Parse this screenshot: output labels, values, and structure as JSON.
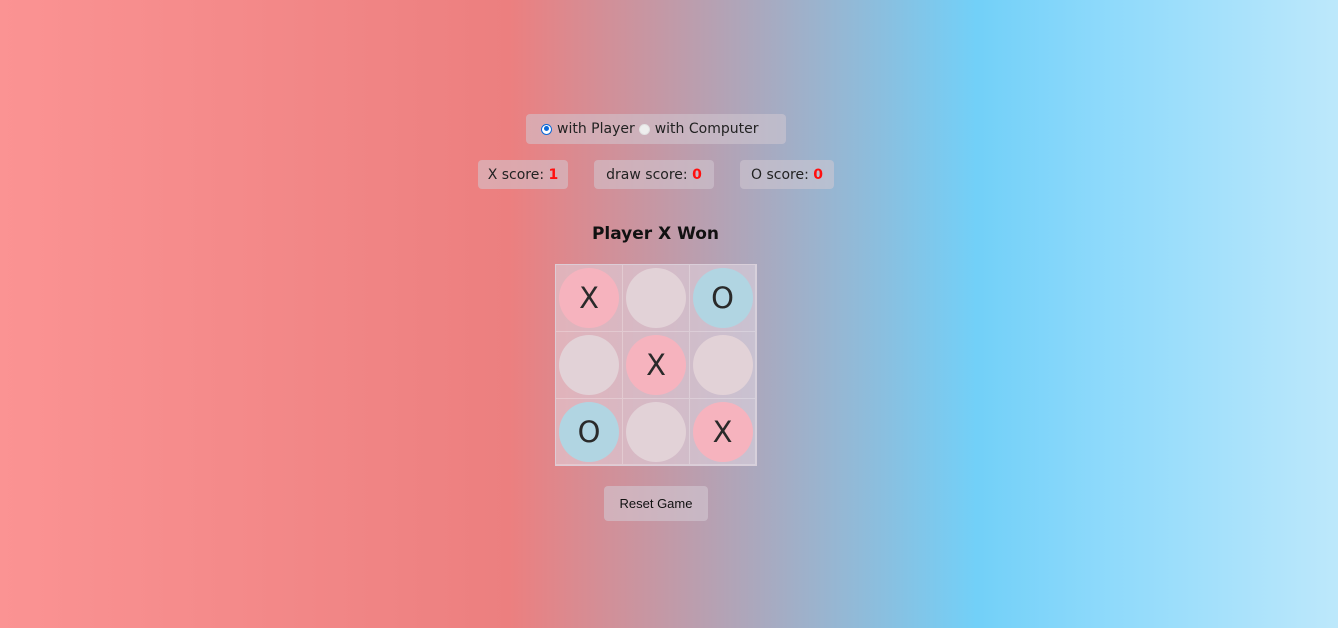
{
  "mode": {
    "options": [
      {
        "label": "with Player",
        "checked": true
      },
      {
        "label": "with Computer",
        "checked": false
      }
    ]
  },
  "scores": {
    "x": {
      "label": "X score:",
      "value": "1"
    },
    "draw": {
      "label": "draw score:",
      "value": "0"
    },
    "o": {
      "label": "O score:",
      "value": "0"
    }
  },
  "status": "Player X Won",
  "board": [
    [
      "X",
      "",
      "O"
    ],
    [
      "",
      "X",
      ""
    ],
    [
      "O",
      "",
      "X"
    ]
  ],
  "colors": {
    "x_cell": "#f6b3be",
    "o_cell": "#b1d5e2",
    "empty_cell": "#e2d2d7",
    "score_value": "#ff0f0f"
  },
  "reset_label": "Reset Game"
}
